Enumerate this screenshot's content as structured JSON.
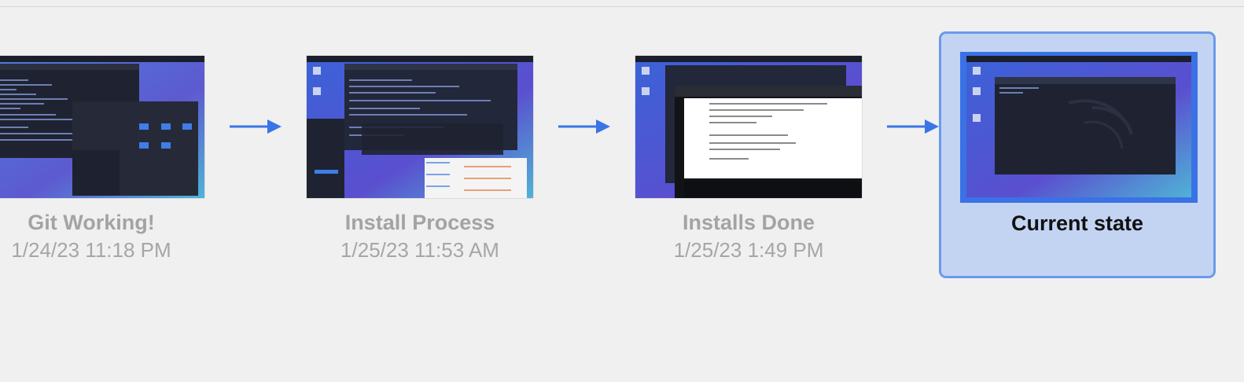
{
  "snapshots": [
    {
      "title": "Git Working!",
      "date": "1/24/23 11:18 PM",
      "selected": false
    },
    {
      "title": "Install Process",
      "date": "1/25/23 11:53 AM",
      "selected": false
    },
    {
      "title": "Installs Done",
      "date": "1/25/23 1:49 PM",
      "selected": false
    },
    {
      "title": "Current state",
      "date": "",
      "selected": true
    }
  ],
  "colors": {
    "arrow": "#3b74e6",
    "selection_fill": "#c3d4f3",
    "selection_border": "#6b9aec",
    "desktop_blue": "#3a5fd6",
    "terminal_dark": "#1e2230"
  },
  "icons": [
    "timeline-arrow-icon",
    "timeline-arrow-icon",
    "timeline-arrow-icon"
  ]
}
